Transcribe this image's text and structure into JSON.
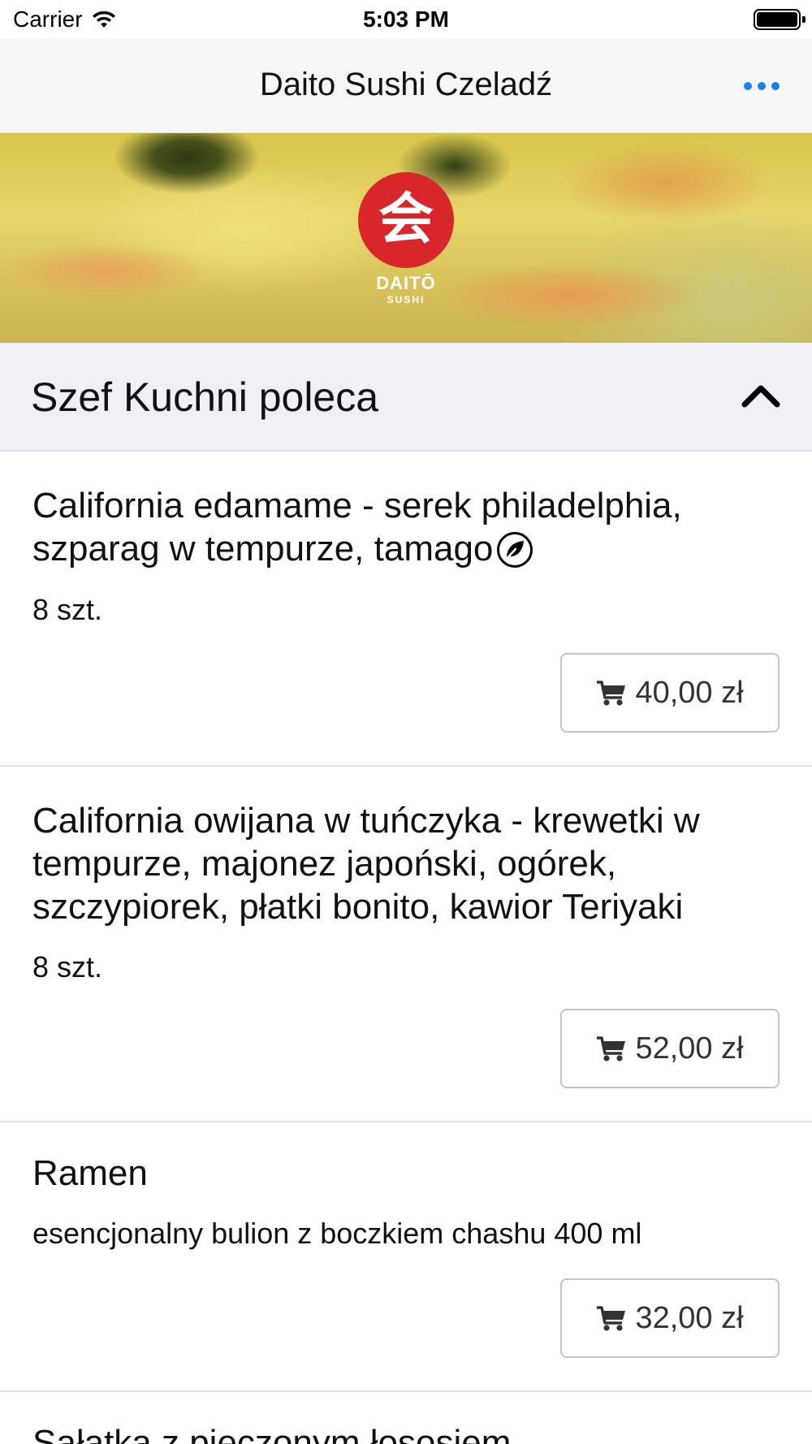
{
  "status_bar": {
    "carrier": "Carrier",
    "time": "5:03 PM"
  },
  "nav": {
    "title": "Daito Sushi Czeladź"
  },
  "banner": {
    "logo_glyph": "会",
    "logo_word": "DAITŌ",
    "logo_sub": "SUSHI"
  },
  "section": {
    "title": "Szef Kuchni poleca"
  },
  "items": [
    {
      "title": "California edamame - serek philadelphia, szparag w tempurze, tamago",
      "vegetarian_icon": "leaf-icon",
      "description": "8 szt.",
      "price": "40,00 zł"
    },
    {
      "title": "California owijana w tuńczyka - krewetki w tempurze, majonez japoński, ogórek, szczypiorek, płatki bonito, kawior Teriyaki",
      "description": "8 szt.",
      "price": "52,00 zł"
    },
    {
      "title": "Ramen",
      "description": "esencjonalny bulion z boczkiem chashu 400 ml",
      "price": "32,00 zł"
    },
    {
      "title": "Sałatka z pieczonym łososiem"
    }
  ],
  "colors": {
    "accent": "#1a7ef7",
    "logo_red": "#d9262b",
    "section_bg": "#f0f0f4",
    "nav_bg": "#f6f6f6"
  },
  "icons": {
    "wifi": "wifi-icon",
    "battery": "battery-icon",
    "more": "more-icon",
    "chevron": "chevron-up-icon",
    "cart": "cart-icon"
  }
}
